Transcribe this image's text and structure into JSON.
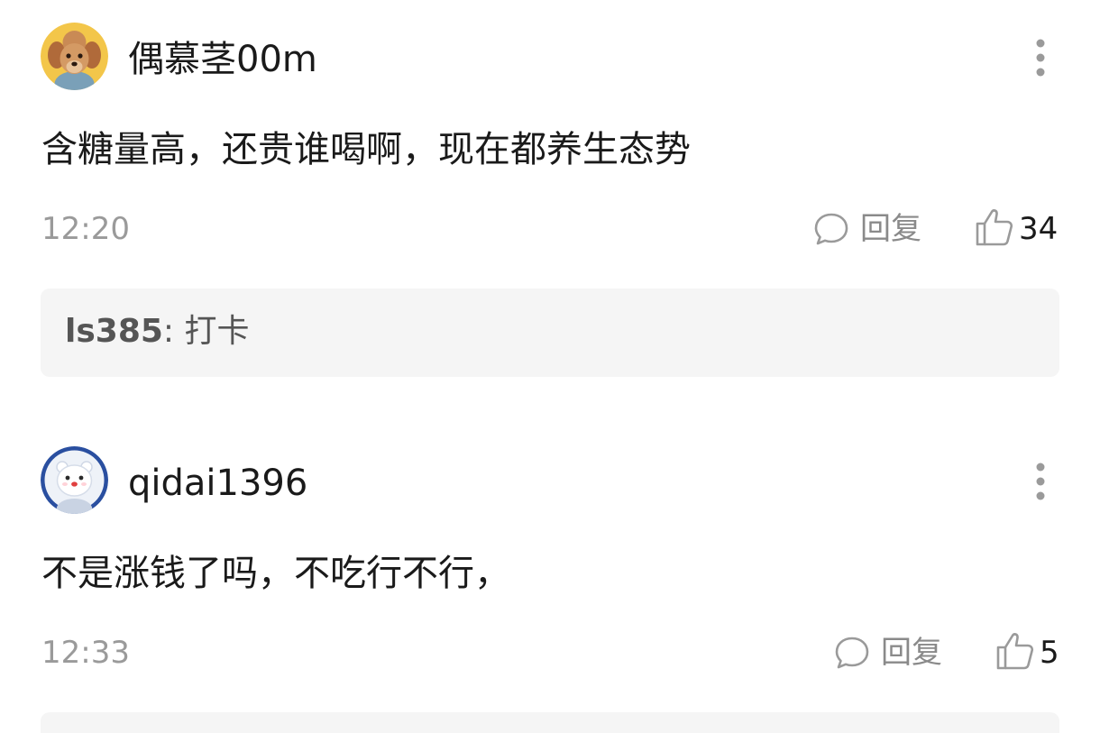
{
  "comments": [
    {
      "avatar": "poodle-dog-avatar",
      "username": "偶慕茎00m",
      "content": "含糖量高，还贵谁喝啊，现在都养生态势",
      "time": "12:20",
      "reply_label": "回复",
      "likes": "34",
      "sub_reply": {
        "user": "ls385",
        "sep": ": ",
        "text": "打卡"
      }
    },
    {
      "avatar": "polar-bear-astronaut-avatar",
      "username": "qidai1396",
      "content": "不是涨钱了吗，不吃行不行，",
      "time": "12:33",
      "reply_label": "回复",
      "likes": "5"
    }
  ],
  "icons": {
    "more": "more-vertical-icon",
    "reply": "comment-bubble-icon",
    "like": "thumbs-up-icon"
  },
  "colors": {
    "text_primary": "#1a1a1a",
    "text_secondary": "#9a9a9a",
    "sub_reply_bg": "#f5f5f5"
  }
}
